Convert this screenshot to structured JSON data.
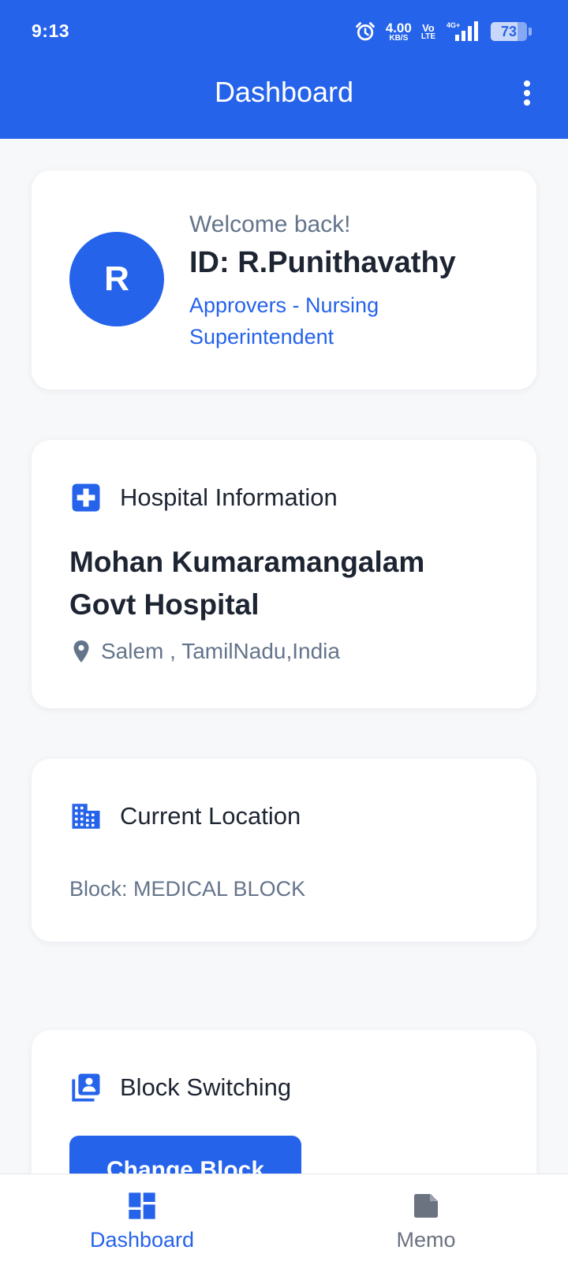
{
  "status_bar": {
    "time": "9:13",
    "net_speed_value": "4.00",
    "net_speed_unit": "KB/S",
    "volte_top": "Vo",
    "volte_bottom": "LTE",
    "network": "4G+",
    "battery_level": "73",
    "icons": [
      "alarm-icon",
      "signal-icon",
      "battery-icon"
    ]
  },
  "app_bar": {
    "title": "Dashboard",
    "menu_icon": "more-vert-icon"
  },
  "welcome_card": {
    "avatar_initial": "R",
    "greeting": "Welcome back!",
    "user_id": "ID: R.Punithavathy",
    "role": "Approvers - Nursing Superintendent"
  },
  "hospital_card": {
    "icon": "medical-cross-icon",
    "title": "Hospital Information",
    "name": "Mohan Kumaramangalam Govt Hospital",
    "address_icon": "location-pin-icon",
    "address": "Salem , TamilNadu,India"
  },
  "location_card": {
    "icon": "building-icon",
    "title": "Current Location",
    "block": "Block: MEDICAL BLOCK"
  },
  "block_card": {
    "icon": "account-box-icon",
    "title": "Block Switching",
    "button_label": "Change Block"
  },
  "bottom_nav": {
    "items": [
      {
        "label": "Dashboard",
        "icon": "dashboard-icon",
        "active": true
      },
      {
        "label": "Memo",
        "icon": "note-icon",
        "active": false
      }
    ]
  },
  "colors": {
    "primary": "#2563eb",
    "text_dark": "#1e2532",
    "text_muted": "#64748b",
    "background": "#f7f8fa"
  }
}
